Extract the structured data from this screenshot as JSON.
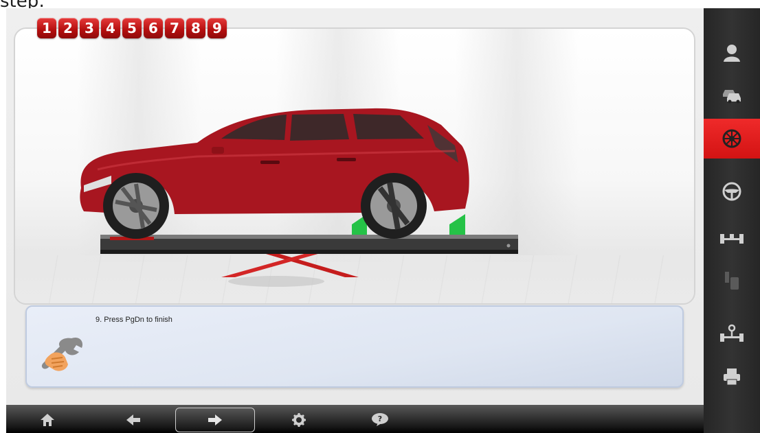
{
  "caption": {
    "text": "step:"
  },
  "steps": [
    "1",
    "2",
    "3",
    "4",
    "5",
    "6",
    "7",
    "8",
    "9"
  ],
  "instruction": {
    "text": "9. Press PgDn to finish"
  },
  "toolbar": {
    "buttons": [
      {
        "name": "home",
        "icon": "home-icon"
      },
      {
        "name": "back",
        "icon": "arrow-left-icon"
      },
      {
        "name": "next",
        "icon": "arrow-right-icon"
      },
      {
        "name": "settings",
        "icon": "gear-icon"
      },
      {
        "name": "help",
        "icon": "question-icon"
      }
    ]
  },
  "sidebar": {
    "items": [
      {
        "name": "customer",
        "icon": "person-icon",
        "active": false
      },
      {
        "name": "vehicle-select",
        "icon": "cars-icon",
        "active": false
      },
      {
        "name": "wheel-runout",
        "icon": "wheel-icon",
        "active": true
      },
      {
        "name": "caster-swing",
        "icon": "steering-wheel-icon",
        "active": false
      },
      {
        "name": "axle-measure",
        "icon": "axle-icon",
        "active": false
      },
      {
        "name": "ride-height",
        "icon": "tire-lift-icon",
        "active": false
      },
      {
        "name": "alignment-adjust",
        "icon": "axle-pin-icon",
        "active": false
      },
      {
        "name": "print-report",
        "icon": "printer-icon",
        "active": false
      }
    ]
  },
  "colors": {
    "accent": "#d71818",
    "sidebar": "#2e2e2e",
    "car": "#a81620",
    "pad": "#25c247"
  }
}
